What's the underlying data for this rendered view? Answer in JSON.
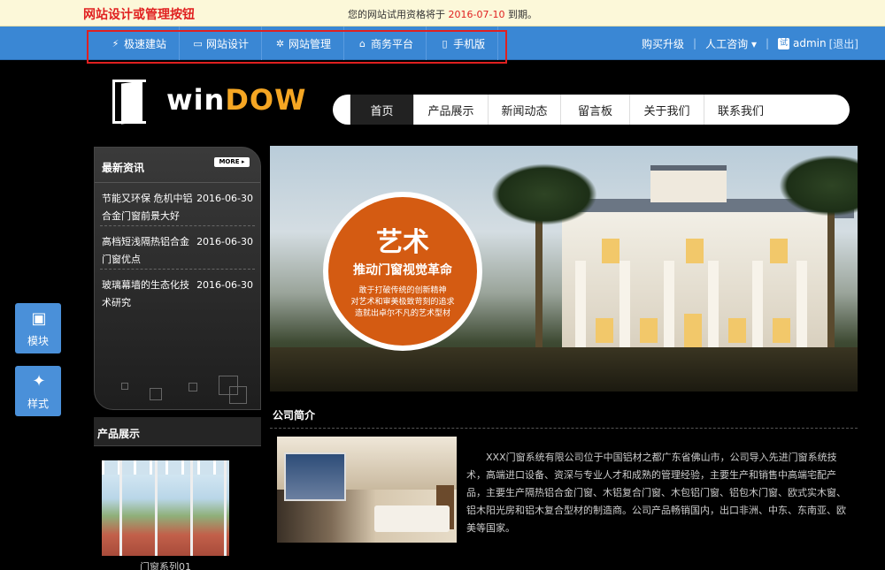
{
  "notice": {
    "label": "网站设计或管理按钮",
    "prefix": "您的网站试用资格将于 ",
    "date": "2016-07-10",
    "suffix": " 到期。"
  },
  "toolbar": {
    "items": [
      {
        "label": "极速建站",
        "icon": "lightning-icon"
      },
      {
        "label": "网站设计",
        "icon": "monitor-icon"
      },
      {
        "label": "网站管理",
        "icon": "gear-icon"
      },
      {
        "label": "商务平台",
        "icon": "home-icon"
      },
      {
        "label": "手机版",
        "icon": "mobile-icon"
      }
    ],
    "upgrade": "购买升级",
    "consult": "人工咨询",
    "user_badge": "试",
    "user": "admin",
    "logout": "[退出]"
  },
  "logo": {
    "text_a": "win",
    "text_b": "DOW"
  },
  "nav": {
    "items": [
      "首页",
      "产品展示",
      "新闻动态",
      "留言板",
      "关于我们",
      "联系我们"
    ]
  },
  "news": {
    "title": "最新资讯",
    "more": "MORE",
    "items": [
      {
        "title": "节能又环保 危机中铝合金门窗前景大好",
        "date": "2016-06-30"
      },
      {
        "title": "高档短浅隔热铝合金门窗优点",
        "date": "2016-06-30"
      },
      {
        "title": "玻璃幕墙的生态化技术研究",
        "date": "2016-06-30"
      }
    ]
  },
  "side_buttons": [
    {
      "label": "模块",
      "icon": "module-add-icon"
    },
    {
      "label": "样式",
      "icon": "magic-wand-icon"
    }
  ],
  "products": {
    "title": "产品展示",
    "caption": "门窗系列01"
  },
  "banner": {
    "big": "艺术",
    "mid": "推动门窗视觉革命",
    "lines": [
      "敢于打破传统的创新精神",
      "对艺术和审美极致苛刻的追求",
      "造就出卓尔不凡的艺术型材"
    ]
  },
  "intro": {
    "title": "公司简介",
    "text": "XXX门窗系统有限公司位于中国铝材之都广东省佛山市，公司导入先进门窗系统技术，高端进口设备、资深与专业人才和成熟的管理经验，主要生产和销售中高端宅配产品，主要生产隔热铝合金门窗、木铝复合门窗、木包铝门窗、铝包木门窗、欧式实木窗、铝木阳光房和铝木复合型材的制造商。公司产品畅销国内，出口非洲、中东、东南亚、欧美等国家。"
  }
}
